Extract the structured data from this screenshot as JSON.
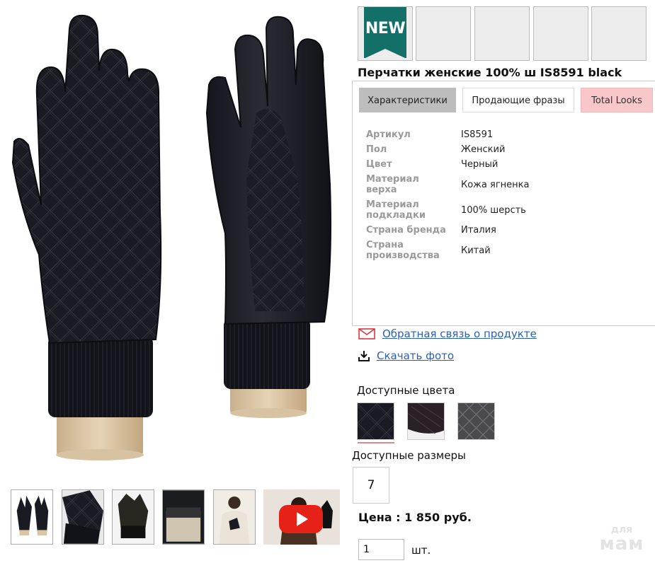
{
  "product": {
    "title": "Перчатки женские 100% ш IS8591 black",
    "badge": "NEW"
  },
  "tabs": [
    {
      "label": "Характеристики",
      "active": true
    },
    {
      "label": "Продающие фразы",
      "active": false
    },
    {
      "label": "Total Looks",
      "active": false
    }
  ],
  "specs": [
    {
      "label": "Артикул",
      "value": "IS8591"
    },
    {
      "label": "Пол",
      "value": "Женский"
    },
    {
      "label": "Цвет",
      "value": "Черный"
    },
    {
      "label": "Материал верха",
      "value": "Кожа ягненка"
    },
    {
      "label": "Материал подкладки",
      "value": "100% шерсть"
    },
    {
      "label": "Страна бренда",
      "value": "Италия"
    },
    {
      "label": "Страна производства",
      "value": "Китай"
    }
  ],
  "links": {
    "feedback": "Обратная связь о продукте",
    "download": "Скачать фото"
  },
  "colors": {
    "label": "Доступные цвета",
    "swatches": [
      "#16171c",
      "#2a2028",
      "#4a4a4c"
    ]
  },
  "sizes": {
    "label": "Доступные размеры",
    "options": [
      "7"
    ]
  },
  "price": "Цена : 1 850 руб.",
  "quantity": {
    "value": "1",
    "unit": "шт."
  },
  "watermark": {
    "line1": "для",
    "line2": "мам"
  },
  "icons": {
    "feedback": "envelope-icon",
    "download": "download-icon",
    "video": "play-icon"
  },
  "palette": {
    "accent_link": "#2a5fb8",
    "badge": "#127068",
    "active_tab": "#bdbdbd",
    "looks_tab": "#f7c7c9",
    "youtube_red": "#e62117"
  }
}
